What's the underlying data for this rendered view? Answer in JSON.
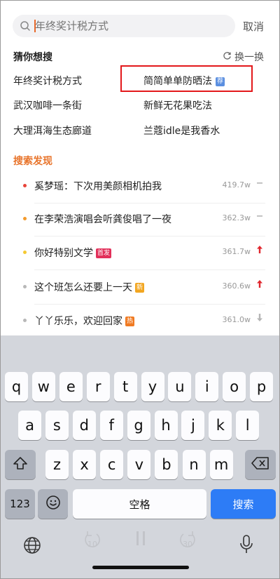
{
  "search": {
    "placeholder": "年终奖计税方式",
    "cancel_label": "取消"
  },
  "guess": {
    "title": "猜你想搜",
    "refresh_label": "换一换",
    "items": [
      {
        "label": "年终奖计税方式"
      },
      {
        "label": "简简单单防晒法",
        "tag": "荐"
      },
      {
        "label": "武汉咖啡一条街"
      },
      {
        "label": "新鲜无花果吃法"
      },
      {
        "label": "大理洱海生态廊道"
      },
      {
        "label": "兰蔻idle是我香水"
      }
    ]
  },
  "hot": {
    "title": "搜索发现",
    "items": [
      {
        "label": "奚梦瑶：下次用美颜相机拍我",
        "count": "419.7w",
        "trend": "flat",
        "dot_color": "#e8443a"
      },
      {
        "label": "在李荣浩演唱会听龚俊唱了一夜",
        "count": "362.3w",
        "trend": "flat",
        "dot_color": "#f39a2c"
      },
      {
        "label": "你好特别文学",
        "badge": "首发",
        "badge_color": "#e2305a",
        "count": "361.7w",
        "trend": "up",
        "dot_color": "#f5c932"
      },
      {
        "label": "这个班怎么还要上一天",
        "badge": "新",
        "badge_color": "#f2a621",
        "count": "360.6w",
        "trend": "up",
        "dot_color": "#b8b8b8"
      },
      {
        "label": "丫丫乐乐，欢迎回家",
        "badge": "热",
        "badge_color": "#f07a22",
        "count": "361.0w",
        "trend": "down",
        "dot_color": "#b8b8b8"
      }
    ]
  },
  "keyboard": {
    "row1": [
      "q",
      "w",
      "e",
      "r",
      "t",
      "y",
      "u",
      "i",
      "o",
      "p"
    ],
    "row2": [
      "a",
      "s",
      "d",
      "f",
      "g",
      "h",
      "j",
      "k",
      "l"
    ],
    "row3": [
      "z",
      "x",
      "c",
      "v",
      "b",
      "n",
      "m"
    ],
    "num_label": "123",
    "space_label": "空格",
    "search_label": "搜索"
  },
  "media": {
    "back_label": "10",
    "forward_label": "30"
  },
  "colors": {
    "accent": "#e8742b",
    "highlight_box": "#e3181b",
    "search_key": "#2d7cf6",
    "trend_up": "#e0262d",
    "trend_neutral": "#b5b5b5"
  }
}
